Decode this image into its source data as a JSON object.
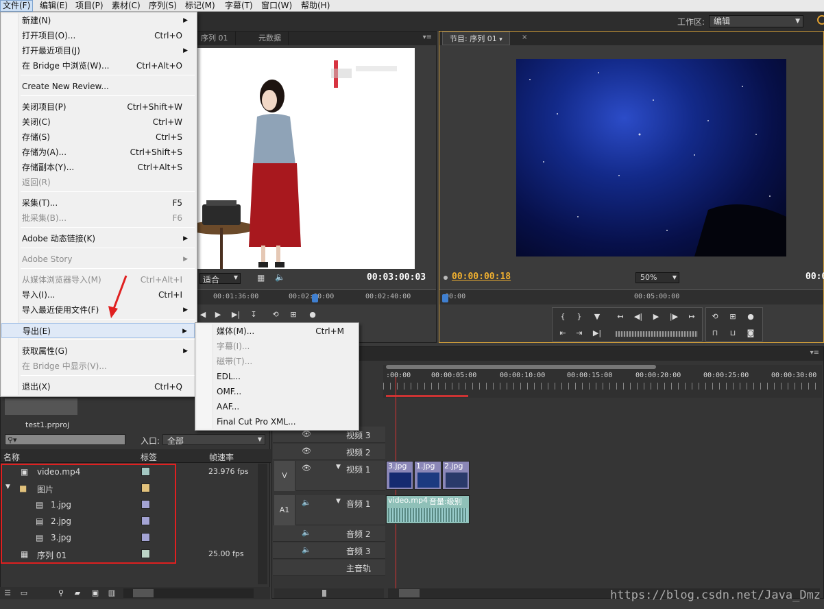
{
  "menubar": [
    "文件(F)",
    "编辑(E)",
    "项目(P)",
    "素材(C)",
    "序列(S)",
    "标记(M)",
    "字幕(T)",
    "窗口(W)",
    "帮助(H)"
  ],
  "workspace": {
    "label": "工作区:",
    "value": "编辑"
  },
  "source_monitor": {
    "tabs": [
      "序列 01",
      "元数据"
    ],
    "fit": "适合",
    "timecode": "00:03:00:03",
    "ruler": [
      "00:01:36:00",
      "00:02:00:00",
      "00:02:40:00"
    ]
  },
  "program_monitor": {
    "tab": "节目: 序列 01",
    "timecode_current": "00:00:00:18",
    "timecode_end": "00:0",
    "zoom": "50%",
    "ruler": [
      "00:00",
      "00:05:00:00"
    ]
  },
  "file_menu": [
    {
      "label": "新建(N)",
      "shortcut": "",
      "sub": true,
      "disabled": false
    },
    {
      "label": "打开项目(O)...",
      "shortcut": "Ctrl+O",
      "sub": false,
      "disabled": false
    },
    {
      "label": "打开最近项目(J)",
      "shortcut": "",
      "sub": true,
      "disabled": false
    },
    {
      "label": "在 Bridge 中浏览(W)...",
      "shortcut": "Ctrl+Alt+O",
      "sub": false,
      "disabled": false
    },
    {
      "label": "Create New Review...",
      "shortcut": "",
      "sub": false,
      "disabled": false
    },
    {
      "label": "关闭项目(P)",
      "shortcut": "Ctrl+Shift+W",
      "sub": false,
      "disabled": false
    },
    {
      "label": "关闭(C)",
      "shortcut": "Ctrl+W",
      "sub": false,
      "disabled": false
    },
    {
      "label": "存储(S)",
      "shortcut": "Ctrl+S",
      "sub": false,
      "disabled": false
    },
    {
      "label": "存储为(A)...",
      "shortcut": "Ctrl+Shift+S",
      "sub": false,
      "disabled": false
    },
    {
      "label": "存储副本(Y)...",
      "shortcut": "Ctrl+Alt+S",
      "sub": false,
      "disabled": false
    },
    {
      "label": "返回(R)",
      "shortcut": "",
      "sub": false,
      "disabled": true
    },
    {
      "label": "采集(T)...",
      "shortcut": "F5",
      "sub": false,
      "disabled": false
    },
    {
      "label": "批采集(B)...",
      "shortcut": "F6",
      "sub": false,
      "disabled": true
    },
    {
      "label": "Adobe 动态链接(K)",
      "shortcut": "",
      "sub": true,
      "disabled": false
    },
    {
      "label": "Adobe Story",
      "shortcut": "",
      "sub": true,
      "disabled": true
    },
    {
      "label": "从媒体浏览器导入(M)",
      "shortcut": "Ctrl+Alt+I",
      "sub": false,
      "disabled": true
    },
    {
      "label": "导入(I)...",
      "shortcut": "Ctrl+I",
      "sub": false,
      "disabled": false
    },
    {
      "label": "导入最近使用文件(F)",
      "shortcut": "",
      "sub": true,
      "disabled": false
    },
    {
      "label": "导出(E)",
      "shortcut": "",
      "sub": true,
      "disabled": false
    },
    {
      "label": "获取属性(G)",
      "shortcut": "",
      "sub": true,
      "disabled": false
    },
    {
      "label": "在 Bridge 中显示(V)...",
      "shortcut": "",
      "sub": false,
      "disabled": true
    },
    {
      "label": "退出(X)",
      "shortcut": "Ctrl+Q",
      "sub": false,
      "disabled": false
    }
  ],
  "export_submenu": [
    {
      "label": "媒体(M)...",
      "shortcut": "Ctrl+M",
      "disabled": false
    },
    {
      "label": "字幕(I)...",
      "shortcut": "",
      "disabled": true
    },
    {
      "label": "磁带(T)...",
      "shortcut": "",
      "disabled": true
    },
    {
      "label": "EDL...",
      "shortcut": "",
      "disabled": false
    },
    {
      "label": "OMF...",
      "shortcut": "",
      "disabled": false
    },
    {
      "label": "AAF...",
      "shortcut": "",
      "disabled": false
    },
    {
      "label": "Final Cut Pro XML...",
      "shortcut": "",
      "disabled": false
    }
  ],
  "project": {
    "filename": "test1.prproj",
    "in_label": "入口:",
    "in_value": "全部",
    "columns": [
      "名称",
      "标签",
      "帧速率"
    ],
    "items": [
      {
        "name": "video.mp4",
        "fps": "23.976 fps",
        "color": "#a3c7c2"
      },
      {
        "name": "图片",
        "fps": "",
        "color": "#e2c27c"
      },
      {
        "name": "1.jpg",
        "fps": "",
        "color": "#a3a3d4"
      },
      {
        "name": "2.jpg",
        "fps": "",
        "color": "#a3a3d4"
      },
      {
        "name": "3.jpg",
        "fps": "",
        "color": "#a3a3d4"
      },
      {
        "name": "序列 01",
        "fps": "25.00 fps",
        "color": "#bcd4c6"
      }
    ]
  },
  "timeline": {
    "ruler": [
      ":00:00",
      "00:00:05:00",
      "00:00:10:00",
      "00:00:15:00",
      "00:00:20:00",
      "00:00:25:00",
      "00:00:30:00"
    ],
    "tracks": {
      "v3": "视频 3",
      "v2": "视频 2",
      "v1": "视频 1",
      "a1": "音频 1",
      "a2": "音频 2",
      "a3": "音频 3",
      "master": "主音轨"
    },
    "v_label": "V",
    "a_label": "A1",
    "clips_v": [
      "3.jpg",
      "1.jpg",
      "2.jpg"
    ],
    "clip_a": "video.mp4",
    "clip_a_extra": "音量:级别"
  },
  "watermark": "https://blog.csdn.net/Java_Dmz"
}
